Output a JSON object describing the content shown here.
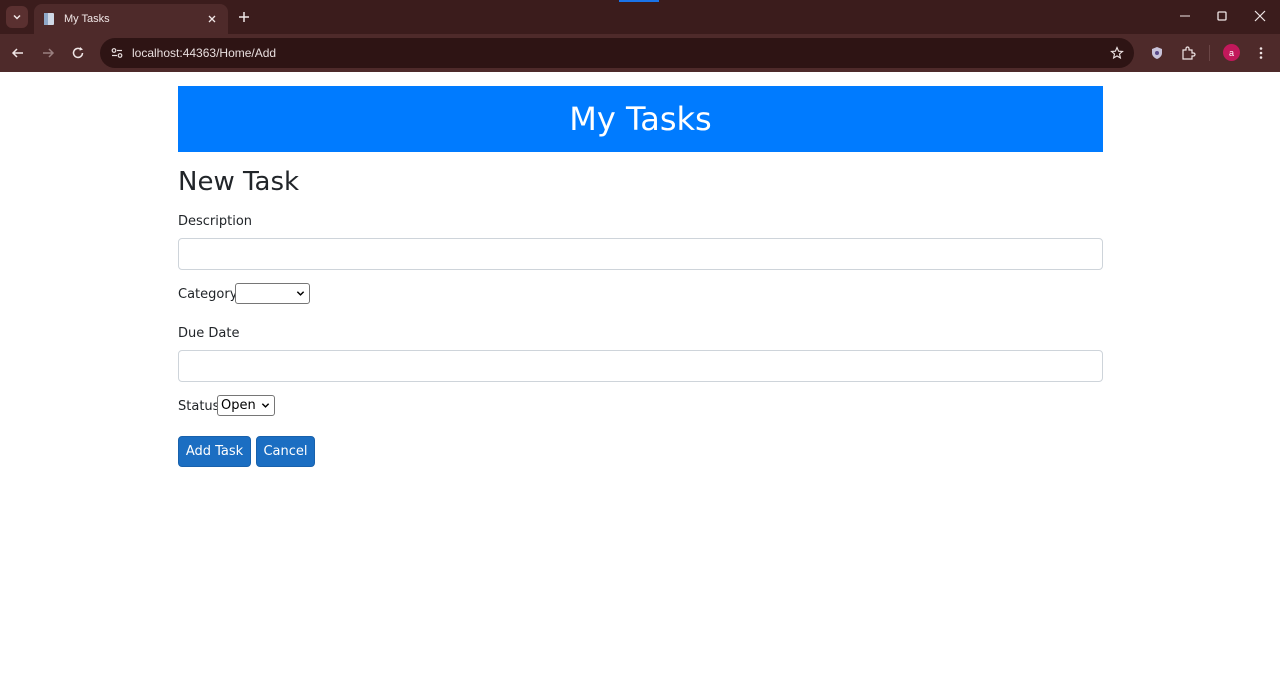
{
  "browser": {
    "tab_title": "My Tasks",
    "url": "localhost:44363/Home/Add",
    "profile_initial": "a"
  },
  "page": {
    "banner_title": "My Tasks",
    "heading": "New Task",
    "form": {
      "description_label": "Description",
      "description_value": "",
      "category_label": "Category",
      "category_selected": "",
      "due_date_label": "Due Date",
      "due_date_value": "",
      "status_label": "Status",
      "status_selected": "Open"
    },
    "buttons": {
      "add_label": "Add Task",
      "cancel_label": "Cancel"
    }
  },
  "colors": {
    "banner": "#007bff",
    "button": "#1b6ec2",
    "chrome_frame": "#3b1c1c",
    "chrome_toolbar": "#4e2a2a"
  }
}
